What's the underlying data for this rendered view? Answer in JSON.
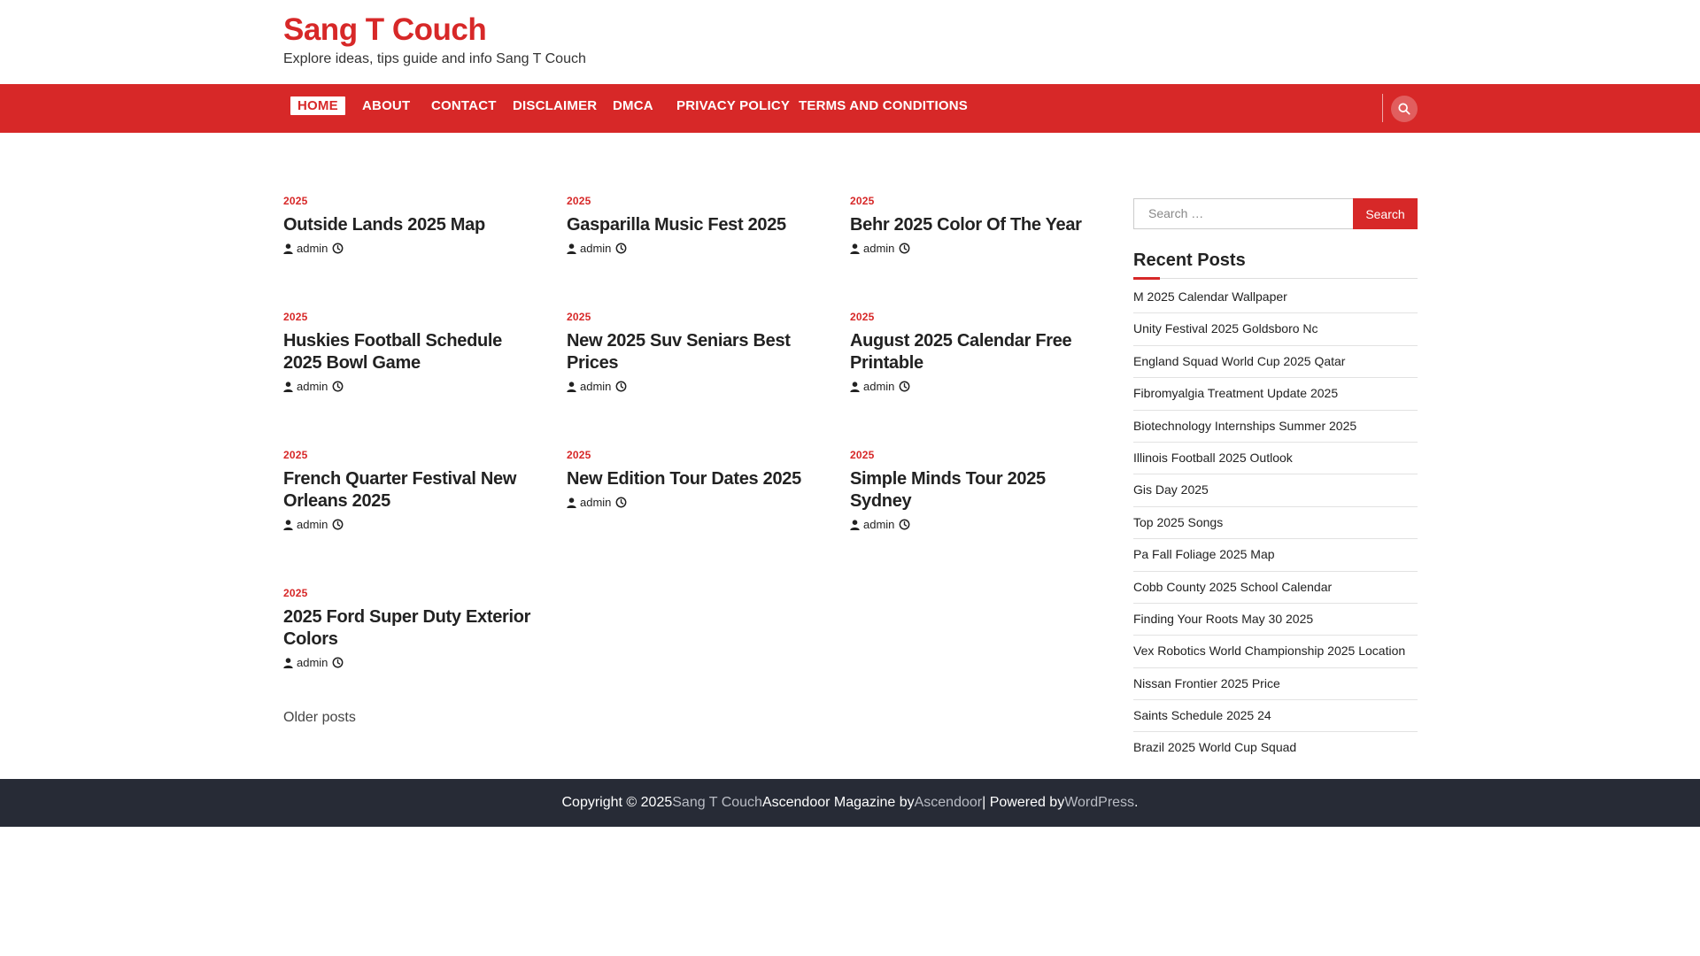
{
  "site": {
    "title": "Sang T Couch",
    "tagline": "Explore ideas, tips guide and info Sang T Couch"
  },
  "nav": {
    "items": [
      {
        "label": "HOME",
        "active": true
      },
      {
        "label": "ABOUT"
      },
      {
        "label": "CONTACT"
      },
      {
        "label": "DISCLAIMER"
      },
      {
        "label": "DMCA"
      },
      {
        "label": "PRIVACY POLICY"
      },
      {
        "label": "TERMS AND CONDITIONS"
      }
    ],
    "search_icon": "search-icon"
  },
  "posts": [
    {
      "category": "2025",
      "title": "Outside Lands 2025 Map",
      "author": "admin"
    },
    {
      "category": "2025",
      "title": "Gasparilla Music Fest 2025",
      "author": "admin"
    },
    {
      "category": "2025",
      "title": "Behr 2025 Color Of The Year",
      "author": "admin"
    },
    {
      "category": "2025",
      "title": "Huskies Football Schedule 2025 Bowl Game",
      "author": "admin"
    },
    {
      "category": "2025",
      "title": "New 2025 Suv Seniars Best Prices",
      "author": "admin"
    },
    {
      "category": "2025",
      "title": "August 2025 Calendar Free Printable",
      "author": "admin"
    },
    {
      "category": "2025",
      "title": "French Quarter Festival New Orleans 2025",
      "author": "admin"
    },
    {
      "category": "2025",
      "title": "New Edition Tour Dates 2025",
      "author": "admin"
    },
    {
      "category": "2025",
      "title": "Simple Minds Tour 2025 Sydney",
      "author": "admin"
    },
    {
      "category": "2025",
      "title": "2025 Ford Super Duty Exterior Colors",
      "author": "admin"
    }
  ],
  "pagination": {
    "older_label": "Older posts"
  },
  "sidebar": {
    "search_placeholder": "Search …",
    "search_button": "Search",
    "recent_title": "Recent Posts",
    "recent_posts": [
      "M 2025 Calendar Wallpaper",
      "Unity Festival 2025 Goldsboro Nc",
      "England Squad World Cup 2025 Qatar",
      "Fibromyalgia Treatment Update 2025",
      "Biotechnology Internships Summer 2025",
      "Illinois Football 2025 Outlook",
      "Gis Day 2025",
      "Top 2025 Songs",
      "Pa Fall Foliage 2025 Map",
      "Cobb County 2025 School Calendar",
      "Finding Your Roots May 30 2025",
      "Vex Robotics World Championship 2025 Location",
      "Nissan Frontier 2025 Price",
      "Saints Schedule 2025 24",
      "Brazil 2025 World Cup Squad"
    ]
  },
  "footer": {
    "copyright": "Copyright © 2025 ",
    "site_link": "Sang T Couch",
    "theme_text": "Ascendoor Magazine by ",
    "theme_link": "Ascendoor",
    "powered_text": " | Powered by ",
    "wp_link": "WordPress",
    "end": "."
  },
  "colors": {
    "accent": "#d72828",
    "footer_bg": "#272b36"
  }
}
